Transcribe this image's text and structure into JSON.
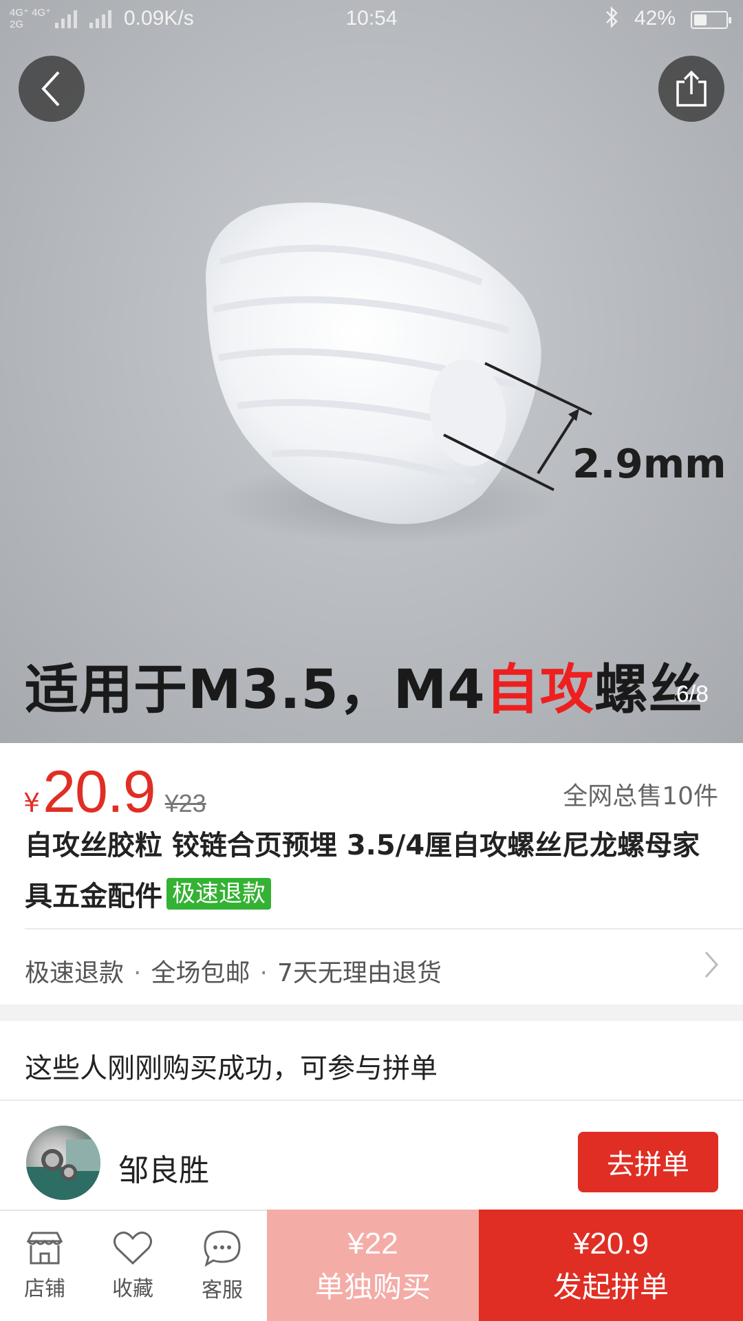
{
  "status_bar": {
    "network": "4G⁺ 4G⁺ 2G",
    "net_top": "4G⁺ 4G⁺",
    "net_bottom": "2G",
    "speed": "0.09K/s",
    "time": "10:54",
    "bluetooth_icon": "bluetooth-icon",
    "battery_percent": "42%",
    "battery_level": 0.42
  },
  "gallery": {
    "dimension_label": "2.9mm",
    "caption_part1": "适用于M3.5，M4",
    "caption_highlight": "自攻",
    "caption_part2": "螺丝",
    "page_indicator": "6/8",
    "highlight_color": "#ee1f1f"
  },
  "product": {
    "currency": "¥",
    "price": "20.9",
    "original_price": "¥23",
    "sold": "全网总售10件",
    "title": "自攻丝胶粒 铰链合页预埋 3.5/4厘自攻螺丝尼龙螺母家具五金配件",
    "tag": "极速退款",
    "services": [
      "极速退款",
      "全场包邮",
      "7天无理由退货"
    ],
    "service_separator": "·"
  },
  "group_buy": {
    "header": "这些人刚刚购买成功，可参与拼单",
    "user_name": "邹良胜",
    "join_label": "去拼单"
  },
  "bottom_bar": {
    "shop": "店铺",
    "favorite": "收藏",
    "service": "客服",
    "single_price": "¥22",
    "single_label": "单独购买",
    "group_price": "¥20.9",
    "group_label": "发起拼单"
  },
  "colors": {
    "accent": "#e02e24",
    "single_button": "#f4aca7",
    "refund_tag": "#34b233"
  }
}
